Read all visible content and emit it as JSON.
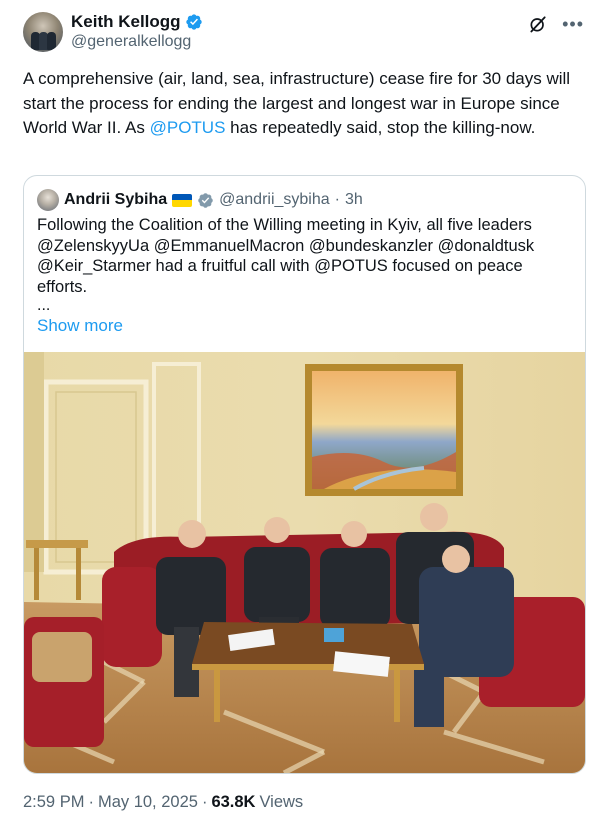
{
  "author": {
    "display_name": "Keith Kellogg",
    "handle": "@generalkellogg"
  },
  "tweet": {
    "text_part1": "A comprehensive (air, land, sea, infrastructure) cease fire for 30 days will start the process for ending the largest and longest war in Europe since World War II.  As ",
    "mention": "@POTUS",
    "text_part2": " has repeatedly said, stop the killing-now."
  },
  "quoted": {
    "display_name": "Andrii Sybiha",
    "handle": "@andrii_sybiha",
    "separator": "·",
    "time": "3h",
    "text": "Following the Coalition of the Willing meeting in Kyiv, all five leaders @ZelenskyyUa @EmmanuelMacron @bundeskanzler @donaldtusk @Keir_Starmer had a fruitful call with @POTUS focused on peace efforts.",
    "ellipsis": "...",
    "show_more": "Show more"
  },
  "meta": {
    "time": "2:59 PM",
    "sep1": "·",
    "date": "May 10, 2025",
    "sep2": "·",
    "views_count": "63.8K",
    "views_label": "Views"
  },
  "icons": {
    "verified": "verified-badge-icon",
    "grok": "grok-icon",
    "more": "more-options-icon",
    "flag": "ukraine-flag-icon"
  },
  "colors": {
    "accent": "#1d9bf0",
    "secondary_text": "#536471",
    "border": "#cfd9de"
  }
}
